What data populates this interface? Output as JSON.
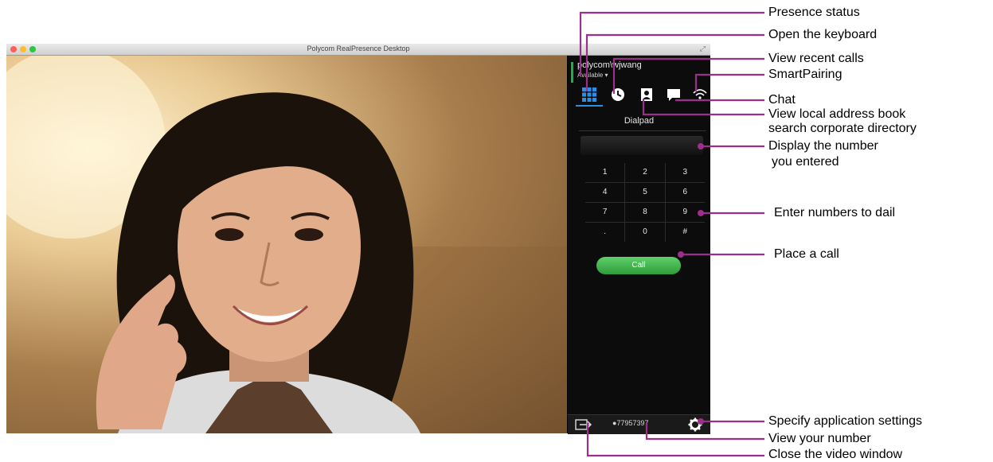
{
  "window": {
    "title": "Polycom RealPresence Desktop",
    "traffic_light_colors": [
      "#ff5f57",
      "#febc2e",
      "#28c840"
    ]
  },
  "video": {
    "content": "video-feed"
  },
  "panel": {
    "user_name": "polycom\\wjwang",
    "presence_status": "Available ▾",
    "presence_color": "#1bb24b",
    "tabs": [
      {
        "icon": "keypad-icon",
        "active": true
      },
      {
        "icon": "recent-calls-icon",
        "active": false
      },
      {
        "icon": "address-book-icon",
        "active": false
      },
      {
        "icon": "chat-icon",
        "active": false
      },
      {
        "icon": "smartpairing-icon",
        "active": false
      }
    ],
    "dialpad_label": "Dialpad",
    "keys": [
      [
        "1",
        "2",
        "3"
      ],
      [
        "4",
        "5",
        "6"
      ],
      [
        "7",
        "8",
        "9"
      ],
      [
        ".",
        "0",
        "#"
      ]
    ],
    "call_label": "Call",
    "call_color": "#3bb34a",
    "my_number": "77957397",
    "accent_color": "#2b8fe6"
  },
  "callouts": {
    "presence_status": "Presence status",
    "open_keyboard": "Open the keyboard",
    "view_recent_calls": "View recent calls",
    "smartpairing": "SmartPairing",
    "chat": "Chat",
    "address_book_line1": "View local address book",
    "address_book_line2": "search corporate directory",
    "display_number_line1": "Display the number",
    "display_number_line2": "you entered",
    "enter_numbers": "Enter numbers to dail",
    "place_call": "Place a call",
    "app_settings": "Specify application settings",
    "view_number": "View your number",
    "close_video": "Close the video window",
    "line_color": "#9c2f8a"
  }
}
